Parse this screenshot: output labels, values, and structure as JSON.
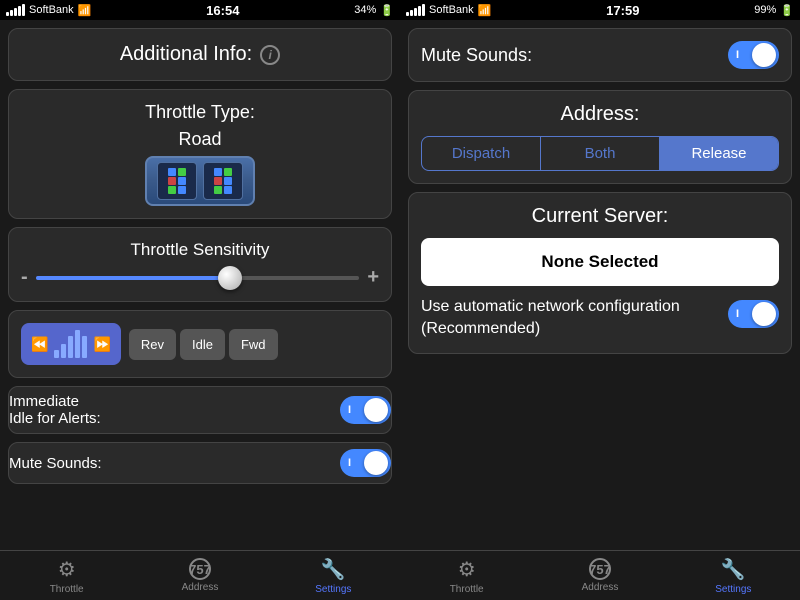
{
  "left": {
    "statusBar": {
      "carrier": "SoftBank",
      "time": "16:54",
      "battery": "34%"
    },
    "additionalInfo": {
      "title": "Additional Info:",
      "icon": "i"
    },
    "throttleType": {
      "label": "Throttle Type:",
      "value": "Road"
    },
    "sensitivity": {
      "label": "Throttle Sensitivity",
      "minus": "-",
      "plus": "+"
    },
    "controls": {
      "rev": "Rev",
      "idle": "Idle",
      "fwd": "Fwd"
    },
    "immediateIdle": {
      "label": "Immediate\nIdle for Alerts:"
    },
    "muteSounds": {
      "label": "Mute Sounds:"
    },
    "tabs": [
      {
        "label": "Throttle",
        "icon": "throttle",
        "active": false
      },
      {
        "label": "Address",
        "icon": "address",
        "active": false
      },
      {
        "label": "Settings",
        "icon": "settings",
        "active": true
      }
    ]
  },
  "right": {
    "statusBar": {
      "carrier": "SoftBank",
      "time": "17:59",
      "battery": "99%"
    },
    "muteCard": {
      "label": "Mute Sounds:"
    },
    "address": {
      "title": "Address:",
      "buttons": [
        "Dispatch",
        "Both",
        "Release"
      ],
      "activeButton": "Release"
    },
    "currentServer": {
      "title": "Current Server:",
      "selectedValue": "None Selected",
      "autoConfigText": "Use automatic network configuration",
      "recommended": "(Recommended)"
    },
    "tabs": [
      {
        "label": "Throttle",
        "icon": "throttle",
        "active": false
      },
      {
        "label": "Address",
        "icon": "address",
        "active": false
      },
      {
        "label": "Settings",
        "icon": "settings",
        "active": true
      }
    ]
  }
}
